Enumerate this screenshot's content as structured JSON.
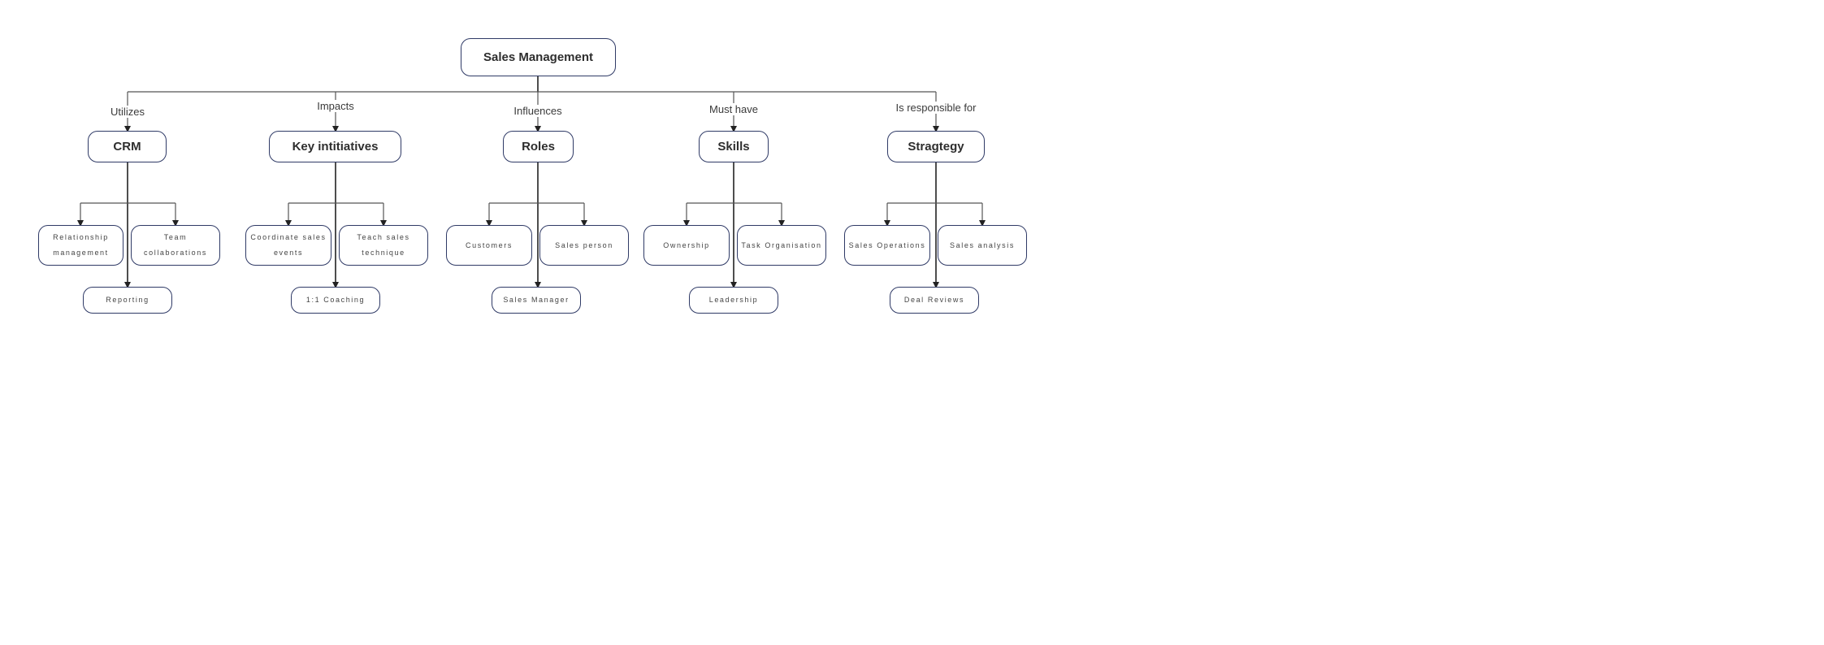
{
  "diagram": {
    "type": "tree",
    "colors": {
      "node_border": "#2f3a66",
      "connector": "#555555",
      "text": "#333333",
      "background": "#ffffff"
    },
    "root": {
      "label": "Sales Management"
    },
    "branches": [
      {
        "relation": "Utilizes",
        "label": "CRM",
        "children": [
          "Relationship management",
          "Team collaborations",
          "Reporting"
        ]
      },
      {
        "relation": "Impacts",
        "label": "Key intitiatives",
        "children": [
          "Coordinate sales events",
          "Teach sales technique",
          "1:1 Coaching"
        ]
      },
      {
        "relation": "Influences",
        "label": "Roles",
        "children": [
          "Customers",
          "Sales person",
          "Sales Manager"
        ]
      },
      {
        "relation": "Must have",
        "label": "Skills",
        "children": [
          "Ownership",
          "Task Organisation",
          "Leadership"
        ]
      },
      {
        "relation": "Is responsible for",
        "label": "Stragtegy",
        "children": [
          "Sales Operations",
          "Sales analysis",
          "Deal Reviews"
        ]
      }
    ]
  }
}
